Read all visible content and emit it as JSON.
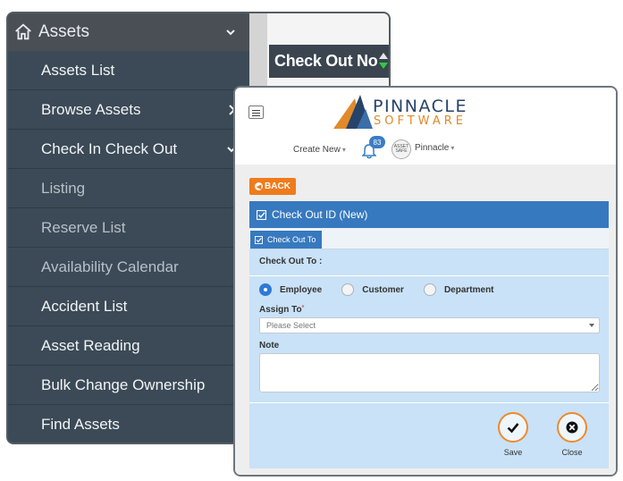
{
  "sidebar": {
    "header": "Assets",
    "items": [
      {
        "label": "Assets List"
      },
      {
        "label": "Browse Assets"
      },
      {
        "label": "Check In Check Out"
      },
      {
        "label": "Listing"
      },
      {
        "label": "Reserve List"
      },
      {
        "label": "Availability Calendar"
      },
      {
        "label": "Accident List"
      },
      {
        "label": "Asset Reading"
      },
      {
        "label": "Bulk Change Ownership"
      },
      {
        "label": "Find Assets"
      }
    ]
  },
  "table": {
    "column_header": "Check Out No"
  },
  "topbar": {
    "logo_line1": "PINNACLE",
    "logo_line2": "SOFTWARE",
    "create_new": "Create New",
    "notification_count": "83",
    "avatar_text": "ASSET SAFE",
    "user_name": "Pinnacle"
  },
  "form": {
    "back_label": "BACK",
    "panel_title": "Check Out ID (New)",
    "tab_label": "Check Out To",
    "check_out_to_label": "Check Out To :",
    "radio_options": [
      {
        "label": "Employee",
        "selected": true
      },
      {
        "label": "Customer",
        "selected": false
      },
      {
        "label": "Department",
        "selected": false
      }
    ],
    "assign_to_label": "Assign To",
    "assign_to_required": "*",
    "assign_to_placeholder": "Please Select",
    "note_label": "Note",
    "save_label": "Save",
    "close_label": "Close"
  },
  "colors": {
    "sidebar_bg": "#3b4a56",
    "primary_blue": "#3779bf",
    "accent_orange": "#ef7b1c",
    "form_bg": "#c9e2f7"
  }
}
